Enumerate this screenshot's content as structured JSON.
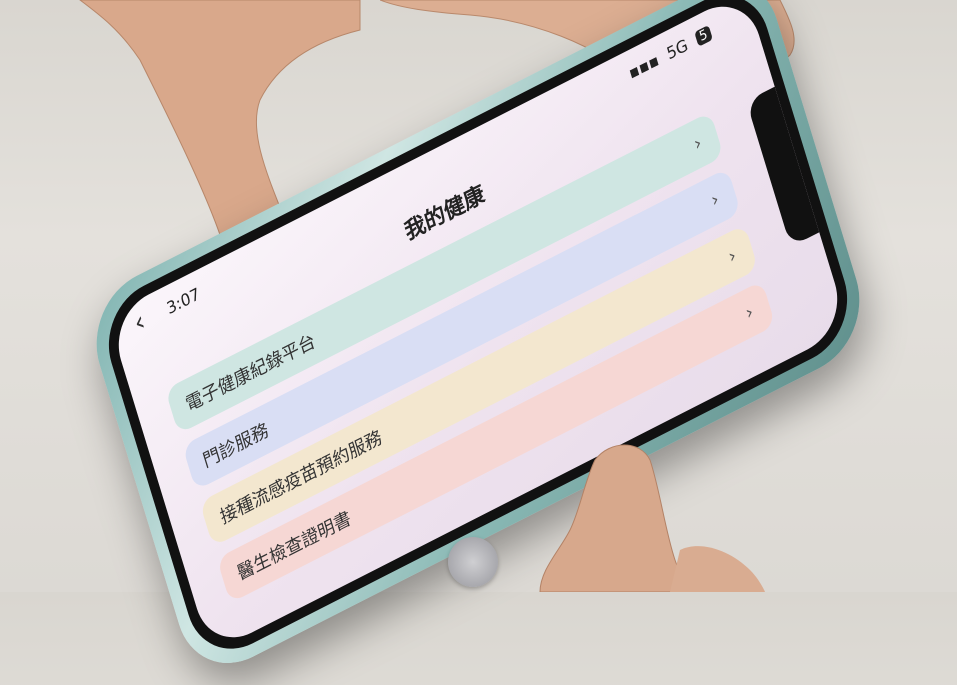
{
  "status_bar": {
    "time": "3:07",
    "signal": "5G",
    "battery_label": "5"
  },
  "header": {
    "back_icon": "chevron-left",
    "title": "我的健康"
  },
  "menu": {
    "items": [
      {
        "label": "電子健康紀錄平台",
        "color": "#cfe6e2"
      },
      {
        "label": "門診服務",
        "color": "#d9def4"
      },
      {
        "label": "接種流感疫苗預約服務",
        "color": "#f3e7cf"
      },
      {
        "label": "醫生檢查證明書",
        "color": "#f6d7d4"
      }
    ],
    "chevron_icon": "chevron-right"
  },
  "colors": {
    "phone_case": "#8ab9b5",
    "screen_bg": "#f4ecf4"
  }
}
